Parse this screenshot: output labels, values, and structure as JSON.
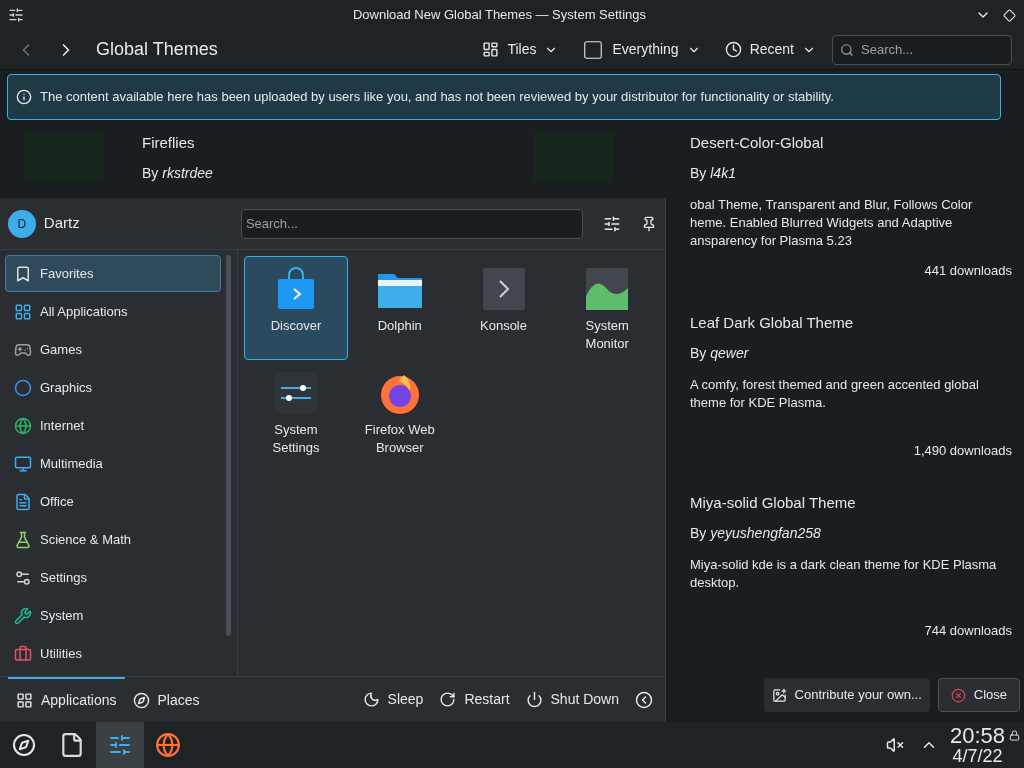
{
  "window": {
    "title": "Download New Global Themes — System Settings"
  },
  "toolbar": {
    "page_title": "Global Themes",
    "view": "Tiles",
    "filter": "Everything",
    "sort": "Recent",
    "search_placeholder": "Search..."
  },
  "banner": "The content available here has been uploaded by users like you, and has not been reviewed by your distributor for functionality or stability.",
  "themes_left": [
    {
      "title": "Fireflies",
      "author": "By *rkstrdee*"
    }
  ],
  "themes_right": [
    {
      "title": "Desert-Color-Global",
      "author": "By *l4k1*",
      "description": [
        "obal Theme, Transparent and Blur, Follows Color",
        "heme. Enabled Blurred Widgets and Adaptive",
        "ansparency for Plasma 5.23"
      ],
      "downloads": "441 downloads"
    },
    {
      "title": "Leaf Dark Global Theme",
      "author": "By *qewer*",
      "description": [
        "A comfy, forest themed and green accented global",
        "theme for KDE Plasma."
      ],
      "downloads": "1,490 downloads"
    },
    {
      "title": "Miya-solid Global Theme",
      "author": "By *yeyushengfan258*",
      "description": [
        "Miya-solid kde is a dark clean theme for KDE Plasma",
        "desktop."
      ],
      "downloads": "744 downloads"
    }
  ],
  "dialog_buttons": [
    "Contribute your own...",
    "Close"
  ],
  "launcher": {
    "user": "Dartz",
    "avatar_letter": "D",
    "search_placeholder": "Search...",
    "categories": [
      {
        "label": "Favorites",
        "selected": true
      },
      {
        "label": "All Applications",
        "selected": false
      },
      {
        "label": "Games",
        "selected": false
      },
      {
        "label": "Graphics",
        "selected": false
      },
      {
        "label": "Internet",
        "selected": false
      },
      {
        "label": "Multimedia",
        "selected": false
      },
      {
        "label": "Office",
        "selected": false
      },
      {
        "label": "Science & Math",
        "selected": false
      },
      {
        "label": "Settings",
        "selected": false
      },
      {
        "label": "System",
        "selected": false
      },
      {
        "label": "Utilities",
        "selected": false
      }
    ],
    "apps": [
      {
        "label": "Discover",
        "selected": true
      },
      {
        "label": "Dolphin",
        "selected": false
      },
      {
        "label": "Konsole",
        "selected": false
      },
      {
        "label": "System Monitor",
        "selected": false
      },
      {
        "label": "System Settings",
        "selected": false
      },
      {
        "label": "Firefox Web Browser",
        "selected": false
      }
    ],
    "tabs": [
      {
        "label": "Applications",
        "selected": true
      },
      {
        "label": "Places",
        "selected": false
      }
    ],
    "power": [
      "Sleep",
      "Restart",
      "Shut Down"
    ]
  },
  "taskbar": {
    "tasks": [
      {
        "active": false
      },
      {
        "active": false
      },
      {
        "active": true
      },
      {
        "active": false
      }
    ],
    "time": "20:58",
    "date": "4/7/22"
  }
}
